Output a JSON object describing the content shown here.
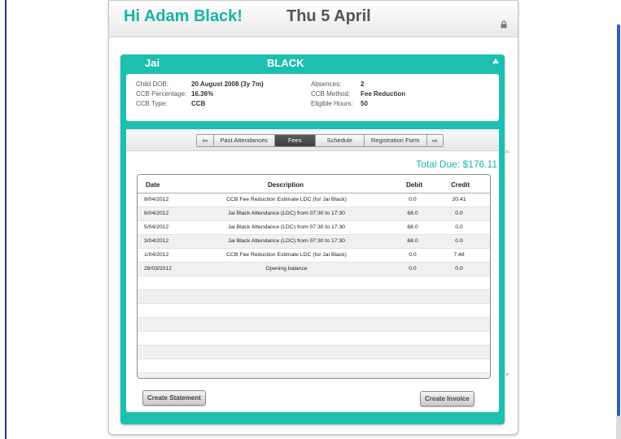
{
  "header": {
    "greeting": "Hi Adam Black!",
    "date": "Thu 5 April"
  },
  "child": {
    "first_name": "Jai",
    "last_name": "BLACK"
  },
  "info": {
    "dob_label": "Child DOB:",
    "dob_value": "20 August 2008 (3y 7m)",
    "ccb_pct_label": "CCB Percentage:",
    "ccb_pct_value": "16.36%",
    "ccb_type_label": "CCB Type:",
    "ccb_type_value": "CCB",
    "absences_label": "Absences:",
    "absences_value": "2",
    "ccb_method_label": "CCB Method:",
    "ccb_method_value": "Fee Reduction",
    "eligible_label": "Eligible Hours:",
    "eligible_value": "50"
  },
  "tabs": {
    "past": "Past Attendances",
    "fees": "Fees",
    "schedule": "Schedule",
    "registration": "Registration Form",
    "left_arrow": "⇦",
    "right_arrow": "⇨"
  },
  "total_due": "Total Due: $176.11",
  "table": {
    "headers": {
      "date": "Date",
      "description": "Description",
      "debit": "Debit",
      "credit": "Credit"
    },
    "rows": [
      {
        "date": "8/04/2012",
        "description": "CCB Fee Reduction Estimate LDC (for Jai Black)",
        "debit": "0.0",
        "credit": "20.41"
      },
      {
        "date": "6/04/2012",
        "description": "Jai Black Attendance (LDC) from 07:30 to 17:30",
        "debit": "68.0",
        "credit": "0.0"
      },
      {
        "date": "5/04/2012",
        "description": "Jai Black Attendance (LDC) from 07:30 to 17:30",
        "debit": "68.0",
        "credit": "0.0"
      },
      {
        "date": "3/04/2012",
        "description": "Jai Black Attendance (LDC) from 07:30 to 17:30",
        "debit": "68.0",
        "credit": "0.0"
      },
      {
        "date": "1/04/2012",
        "description": "CCB Fee Reduction Estimate LDC (for Jai Black)",
        "debit": "0.0",
        "credit": "7.48"
      },
      {
        "date": "28/03/2012",
        "description": "Opening balance",
        "debit": "0.0",
        "credit": "0.0"
      }
    ]
  },
  "buttons": {
    "create_statement": "Create Statement",
    "create_invoice": "Create Invoice"
  }
}
